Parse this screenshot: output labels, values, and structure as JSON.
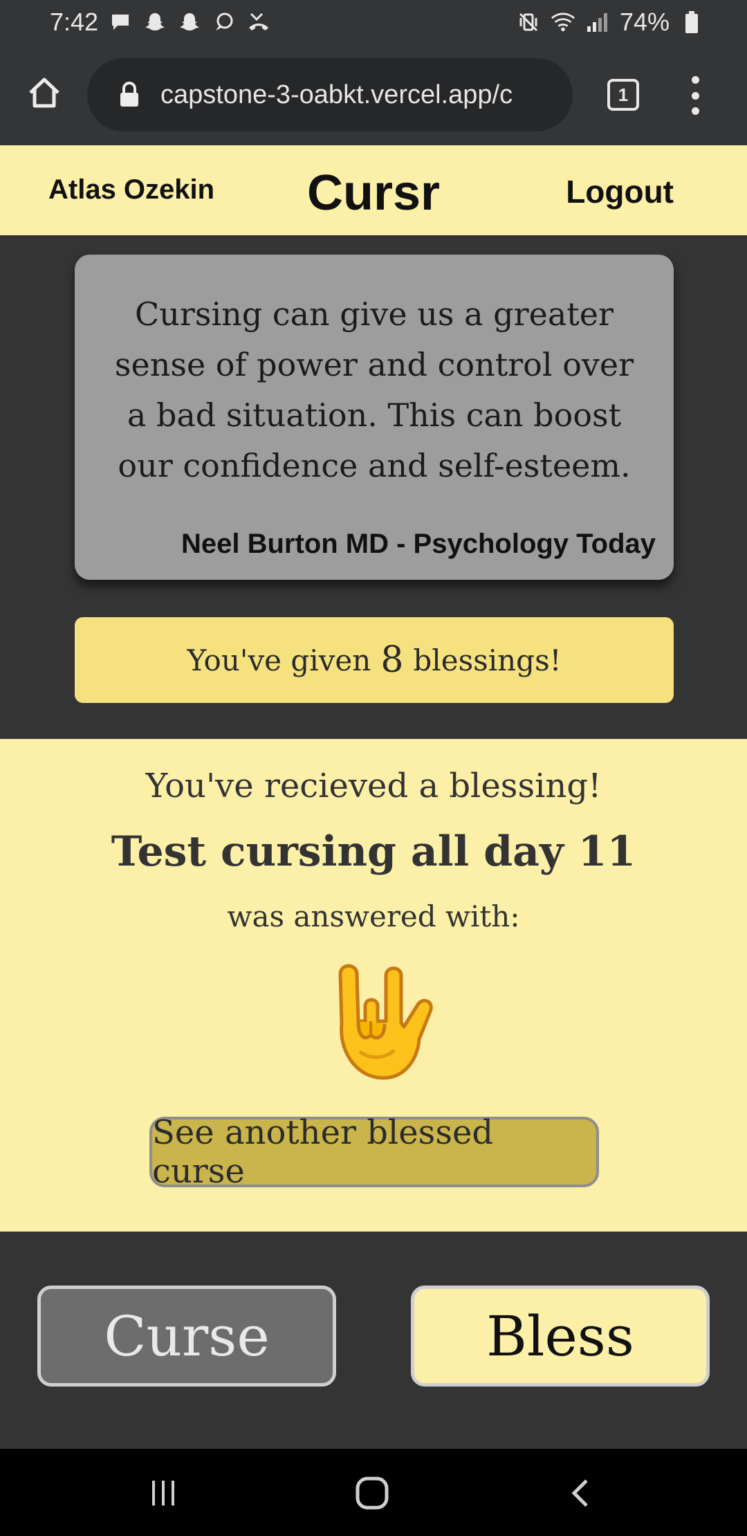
{
  "status_bar": {
    "time": "7:42",
    "battery": "74%",
    "left_icons": [
      "message-icon",
      "snapchat-icon",
      "snapchat-icon",
      "chat-bubble-icon",
      "missed-call-icon"
    ],
    "right_icons": [
      "vibrate-icon",
      "wifi-icon",
      "signal-icon",
      "battery-icon"
    ]
  },
  "browser": {
    "url": "capstone-3-oabkt.vercel.app/c",
    "tab_count": "1"
  },
  "header": {
    "user_name": "Atlas Ozekin",
    "brand": "Cursr",
    "logout_label": "Logout"
  },
  "quote": {
    "text": "Cursing can give us a greater sense of power and control over a bad situation. This can boost our confidence and self-esteem.",
    "source": "Neel Burton MD - Psychology Today"
  },
  "blessings": {
    "prefix": "You've given",
    "count": "8",
    "suffix": "blessings!"
  },
  "received": {
    "heading": "You've recieved a blessing!",
    "curse_text": "Test cursing all day 11",
    "answered_label": "was answered with:",
    "emoji_icon": "love-you-gesture-icon",
    "another_button_label": "See another blessed curse"
  },
  "actions": {
    "curse_label": "Curse",
    "bless_label": "Bless"
  },
  "colors": {
    "app_background": "#343434",
    "header_background": "#fcefa7",
    "banner_background": "#f6e17f",
    "button_gold": "#c9b54c",
    "quote_card": "#9d9d9d",
    "curse_button": "#6d6d6d"
  },
  "nav_bar": {
    "icons": [
      "recent-apps-icon",
      "home-icon",
      "back-icon"
    ]
  }
}
